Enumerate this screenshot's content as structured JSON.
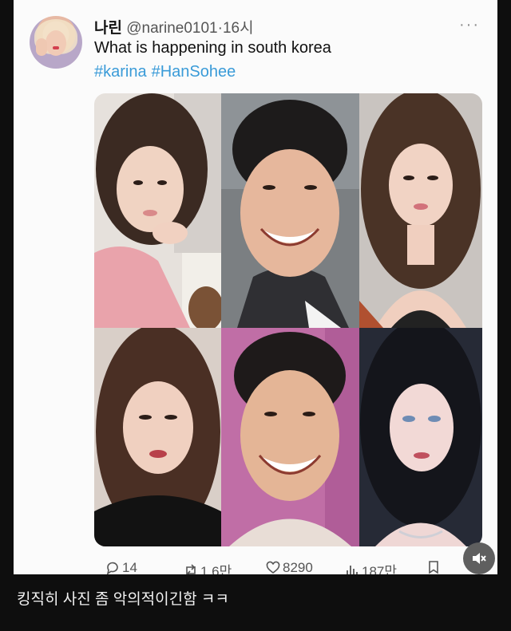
{
  "tweet": {
    "display_name": "나린",
    "handle": "@narine0101",
    "separator": "·",
    "time": "16시",
    "text": "What is happening in south korea",
    "hashtags": [
      "#karina",
      "#HanSohee"
    ],
    "photos": [
      {
        "description": "woman-chin-on-hand-pink-sweater",
        "bg": "#e6e1dc"
      },
      {
        "description": "man-grinning-dark-hair",
        "bg": "#7b7f82"
      },
      {
        "description": "woman-long-brown-hair-pout",
        "bg": "#c9c4c0"
      },
      {
        "description": "woman-brown-hair-red-lips",
        "bg": "#d9cfc8"
      },
      {
        "description": "man-wide-smile-pink-backdrop",
        "bg": "#c06ea6"
      },
      {
        "description": "woman-black-hair-blue-eyes",
        "bg": "#262a36"
      }
    ],
    "stats": {
      "replies": "14",
      "retweets": "1.6만",
      "likes": "8290",
      "views": "187만"
    }
  },
  "caption": "킹직히 사진 좀 악의적이긴함 ㅋㅋ",
  "icons": {
    "more": "more-options-icon",
    "reply": "reply-icon",
    "retweet": "retweet-icon",
    "like": "heart-icon",
    "views": "views-chart-icon",
    "bookmark": "bookmark-icon",
    "mute": "muted-speaker-icon"
  },
  "colors": {
    "hashtag": "#3a9bd8",
    "card_bg": "#fbfbfb",
    "page_bg": "#0e0e0e"
  }
}
